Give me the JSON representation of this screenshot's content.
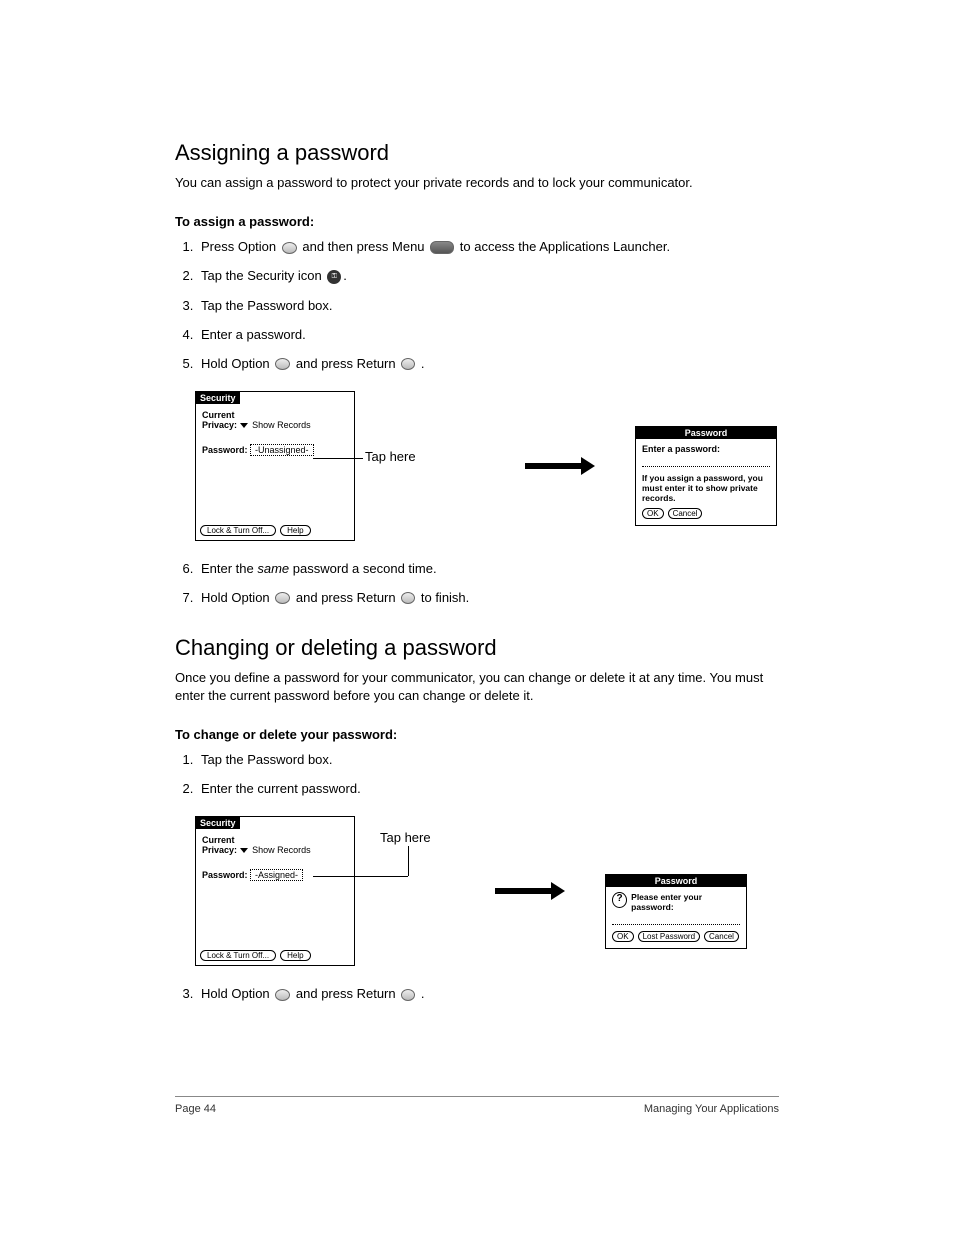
{
  "section1": {
    "heading": "Assigning a password",
    "intro": "You can assign a password to protect your private records and to lock your communicator.",
    "subhead": "To assign a password:",
    "steps": {
      "s1a": "Press Option ",
      "s1b": " and then press Menu ",
      "s1c": " to access the Applications Launcher.",
      "s2a": "Tap the Security icon ",
      "s2b": ".",
      "s3": "Tap the Password box.",
      "s4": "Enter a password.",
      "s5a": "Hold Option ",
      "s5b": " and press Return ",
      "s5c": ".",
      "s6a": "Enter the ",
      "s6em": "same",
      "s6b": " password a second time.",
      "s7a": "Hold Option ",
      "s7b": " and press Return ",
      "s7c": " to finish."
    }
  },
  "figure1": {
    "screenTitle": "Security",
    "currentLabel": "Current",
    "privacyLabel": "Privacy:",
    "privacyValue": "Show Records",
    "passwordLabel": "Password:",
    "passwordValue": "-Unassigned-",
    "lockBtn": "Lock & Turn Off...",
    "helpBtn": "Help",
    "callout": "Tap here",
    "dialogTitle": "Password",
    "dialogPrompt": "Enter a password:",
    "dialogNote": "If you assign a password, you must enter it to show private records.",
    "ok": "OK",
    "cancel": "Cancel"
  },
  "section2": {
    "heading": "Changing or deleting a password",
    "intro": "Once you define a password for your communicator, you can change or delete it at any time. You must enter the current password before you can change or delete it.",
    "subhead": "To change or delete your password:",
    "steps": {
      "s1": "Tap the Password box.",
      "s2": "Enter the current password.",
      "s3a": "Hold Option ",
      "s3b": " and press Return ",
      "s3c": "."
    }
  },
  "figure2": {
    "screenTitle": "Security",
    "currentLabel": "Current",
    "privacyLabel": "Privacy:",
    "privacyValue": "Show Records",
    "passwordLabel": "Password:",
    "passwordValue": "-Assigned-",
    "lockBtn": "Lock & Turn Off...",
    "helpBtn": "Help",
    "callout": "Tap here",
    "dialogTitle": "Password",
    "dialogPrompt": "Please enter your password:",
    "ok": "OK",
    "lost": "Lost Password",
    "cancel": "Cancel"
  },
  "footer": {
    "left": "Page 44",
    "right": "Managing Your Applications"
  }
}
